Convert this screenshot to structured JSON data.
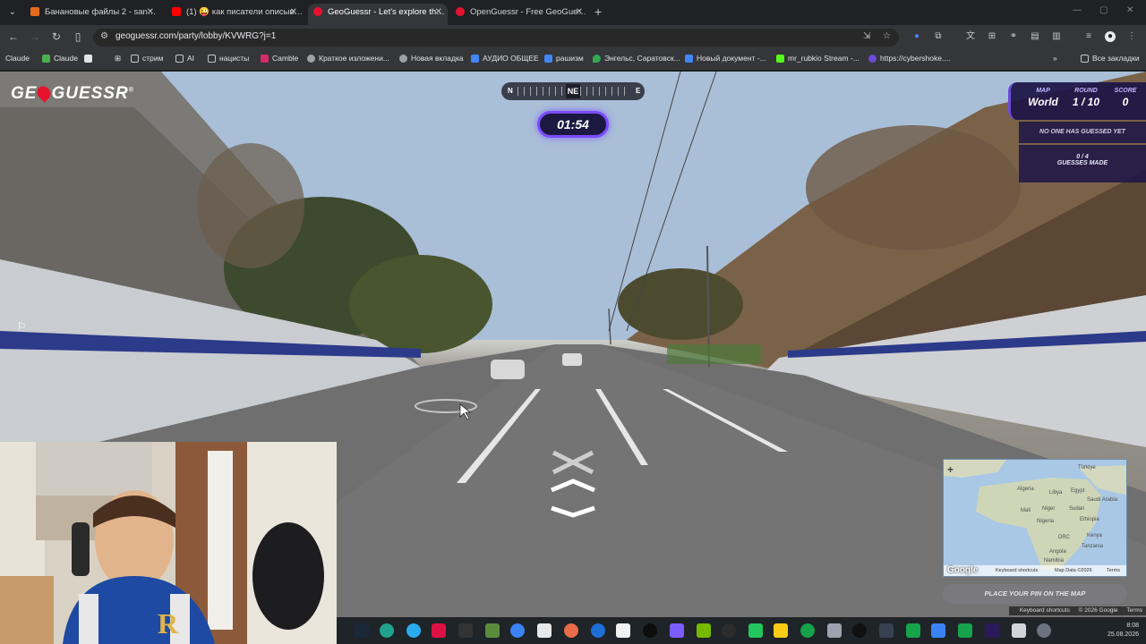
{
  "browser": {
    "tabs": [
      {
        "title": "Банановые файлы 2 - sansgol",
        "active": false,
        "favicon_color": "#e86b1b"
      },
      {
        "title": "(1) 😜 как писатели описывают",
        "active": false,
        "favicon_color": "#ff0000"
      },
      {
        "title": "GeoGuessr - Let's explore the w",
        "active": true,
        "favicon_color": "#e8112d"
      },
      {
        "title": "OpenGuessr - Free GeoGuessr A",
        "active": false,
        "favicon_color": "#e8112d"
      }
    ],
    "url": "geoguessr.com/party/lobby/KVWRG?j=1",
    "bookmarks": [
      {
        "label": "Claude",
        "color": "#d97757"
      },
      {
        "label": "Claude",
        "color": "#4caf50"
      },
      {
        "label": "стрим",
        "color": "#c4c7c5"
      },
      {
        "label": "AI",
        "color": "#c4c7c5"
      },
      {
        "label": "нацисты",
        "color": "#c4c7c5"
      },
      {
        "label": "Camble",
        "color": "#d62b6a"
      },
      {
        "label": "Краткое изложени...",
        "color": "#9aa0a6"
      },
      {
        "label": "Новая вкладка",
        "color": "#9aa0a6"
      },
      {
        "label": "АУДИО ОБЩЕЕ",
        "color": "#4285f4"
      },
      {
        "label": "рашизм",
        "color": "#4285f4"
      },
      {
        "label": "Энгельс, Саратовск...",
        "color": "#34a853"
      },
      {
        "label": "Новый документ -...",
        "color": "#4285f4"
      },
      {
        "label": "mr_rubkio Stream -...",
        "color": "#53fc18"
      },
      {
        "label": "https://cybershoke....",
        "color": "#6b4cd6"
      }
    ],
    "all_bookmarks": "Все закладки"
  },
  "game": {
    "compass": {
      "left": "N",
      "current": "NE",
      "right": "E"
    },
    "timer": "01:54",
    "map_label": "MAP",
    "map_value": "World",
    "round_label": "ROUND",
    "round_value": "1 / 10",
    "score_label": "SCORE",
    "score_value": "0",
    "guess_status": "NO ONE HAS GUESSED YET",
    "guesses_count": "0 / 4",
    "guesses_label": "GUESSES MADE",
    "place_pin": "PLACE YOUR PIN ON THE MAP",
    "minimap": {
      "zoom": "+",
      "countries": [
        "Türkiye",
        "Algeria",
        "Libya",
        "Egypt",
        "Saudi Arabia",
        "Mali",
        "Niger",
        "Sudan",
        "Nigeria",
        "Ethiopia",
        "Kenya",
        "DRC",
        "Tanzania",
        "Angola",
        "Namibia"
      ],
      "logo": "Google",
      "footer": [
        "Keyboard shortcuts",
        "Map Data ©2026",
        "Terms"
      ]
    },
    "credits": [
      "Keyboard shortcuts",
      "© 2026 Google",
      "Terms"
    ]
  },
  "logo_text": "GEOGUESSR",
  "taskbar": {
    "time": "8:08",
    "date": "25.08.2026"
  }
}
